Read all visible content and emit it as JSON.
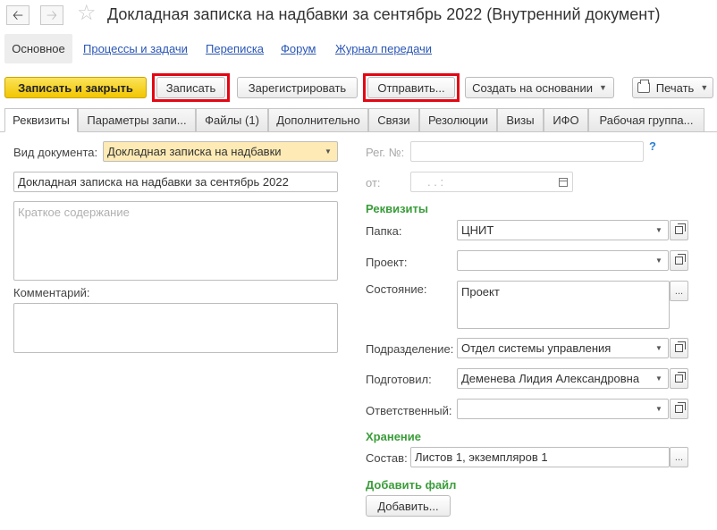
{
  "window": {
    "title": "Докладная записка на надбавки за сентябрь 2022 (Внутренний документ)"
  },
  "nav": {
    "back_icon": "arrow-left-icon",
    "forward_icon": "arrow-right-icon",
    "favorite_icon": "star-icon",
    "tabs": [
      {
        "label": "Основное"
      },
      {
        "label": "Процессы и задачи"
      },
      {
        "label": "Переписка"
      },
      {
        "label": "Форум"
      },
      {
        "label": "Журнал передачи"
      }
    ]
  },
  "toolbar": {
    "save_close": "Записать и закрыть",
    "save": "Записать",
    "register": "Зарегистрировать",
    "send": "Отправить...",
    "create_based": "Создать на основании",
    "print": "Печать"
  },
  "tabs": [
    {
      "label": "Реквизиты"
    },
    {
      "label": "Параметры запи..."
    },
    {
      "label": "Файлы (1)"
    },
    {
      "label": "Дополнительно"
    },
    {
      "label": "Связи"
    },
    {
      "label": "Резолюции"
    },
    {
      "label": "Визы"
    },
    {
      "label": "ИФО"
    },
    {
      "label": "Рабочая группа..."
    }
  ],
  "form": {
    "doc_type_label": "Вид документа:",
    "doc_type_value": "Докладная записка на надбавки",
    "title_value": "Докладная записка на надбавки за сентябрь 2022",
    "summary_placeholder": "Краткое содержание",
    "comment_label": "Комментарий:",
    "reg_no_label": "Рег. №:",
    "reg_no_value": "",
    "help": "?",
    "date_label": "от:",
    "date_value": ". .   :",
    "requisites_section": "Реквизиты",
    "folder_label": "Папка:",
    "folder_value": "ЦНИТ",
    "project_label": "Проект:",
    "project_value": "",
    "state_label": "Состояние:",
    "state_value": "Проект",
    "division_label": "Подразделение:",
    "division_value": "Отдел системы управления",
    "prepared_label": "Подготовил:",
    "prepared_value": "Деменева Лидия Александровна",
    "responsible_label": "Ответственный:",
    "responsible_value": "",
    "storage_section": "Хранение",
    "composition_label": "Состав:",
    "composition_value": "Листов 1, экземпляров 1",
    "add_file_section": "Добавить файл",
    "add_button": "Добавить...",
    "ellipsis": "..."
  },
  "colors": {
    "primary_button": "#f2c600",
    "highlight_box": "#e30613",
    "section_header": "#3a9d3a",
    "link": "#2a56b4",
    "required_field": "#fdeab4"
  }
}
